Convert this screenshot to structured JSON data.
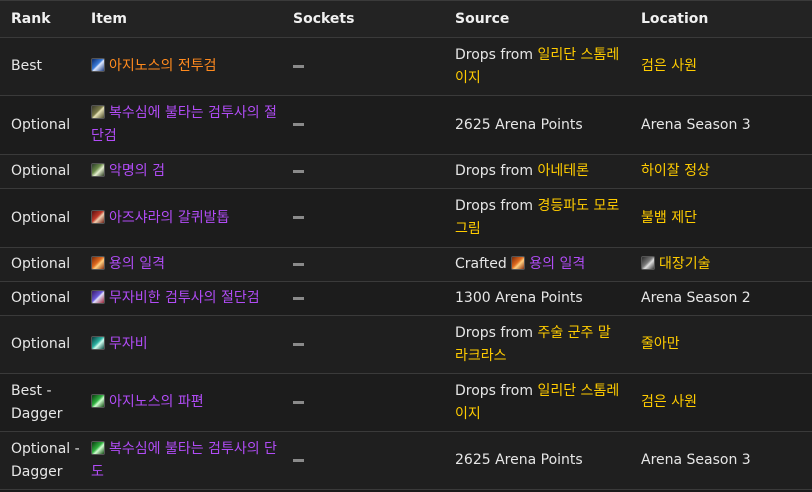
{
  "headers": {
    "rank": "Rank",
    "item": "Item",
    "sockets": "Sockets",
    "source": "Source",
    "location": "Location"
  },
  "rows": [
    {
      "rank": "Best",
      "icon": "sword-icon",
      "item": "아지노스의 전투검",
      "item_color": "orange",
      "source_prefix": "Drops from ",
      "source_name": "일리단 스톰레이지",
      "source_icon": "",
      "location": "검은 사원",
      "location_icon": ""
    },
    {
      "rank": "Optional",
      "icon": "blade-icon",
      "item": "복수심에 불타는 검투사의 절단검",
      "item_color": "purple",
      "source_prefix": "2625 Arena Points",
      "source_name": "",
      "source_icon": "",
      "location": "Arena Season 3",
      "location_icon": ""
    },
    {
      "rank": "Optional",
      "icon": "wing-sword-icon",
      "item": "악명의 검",
      "item_color": "purple",
      "source_prefix": "Drops from ",
      "source_name": "아네테론",
      "source_icon": "",
      "location": "하이잘 정상",
      "location_icon": ""
    },
    {
      "rank": "Optional",
      "icon": "claw-icon",
      "item": "아즈샤라의 갈퀴발톱",
      "item_color": "purple",
      "source_prefix": "Drops from ",
      "source_name": "경등파도 모로그림",
      "source_icon": "",
      "location": "불뱀 제단",
      "location_icon": ""
    },
    {
      "rank": "Optional",
      "icon": "dragon-icon",
      "item": "용의 일격",
      "item_color": "purple",
      "source_prefix": "Crafted ",
      "source_name": "용의 일격",
      "source_icon": "dragon-icon",
      "location": "대장기술",
      "location_icon": "gear-icon"
    },
    {
      "rank": "Optional",
      "icon": "pole-icon",
      "item": "무자비한 검투사의 절단검",
      "item_color": "purple",
      "source_prefix": "1300 Arena Points",
      "source_name": "",
      "source_icon": "",
      "location": "Arena Season 2",
      "location_icon": ""
    },
    {
      "rank": "Optional",
      "icon": "teal-sword-icon",
      "item": "무자비",
      "item_color": "purple",
      "source_prefix": "Drops from ",
      "source_name": "주술 군주 말라크라스",
      "source_icon": "",
      "location": "줄아만",
      "location_icon": ""
    },
    {
      "rank": "Best - Dagger",
      "icon": "green-dagger-icon",
      "item": "아지노스의 파편",
      "item_color": "purple",
      "source_prefix": "Drops from ",
      "source_name": "일리단 스톰레이지",
      "source_icon": "",
      "location": "검은 사원",
      "location_icon": ""
    },
    {
      "rank": "Optional - Dagger",
      "icon": "green-dagger-icon",
      "item": "복수심에 불타는 검투사의 단도",
      "item_color": "purple",
      "source_prefix": "2625 Arena Points",
      "source_name": "",
      "source_icon": "",
      "location": "Arena Season 3",
      "location_icon": ""
    }
  ],
  "colors": {
    "background": "#1a1a1a",
    "epic_purple": "#b14cf6",
    "legendary_orange": "#ff8a1e",
    "highlight_gold": "#ffcc00",
    "text": "#e6e6e6"
  }
}
